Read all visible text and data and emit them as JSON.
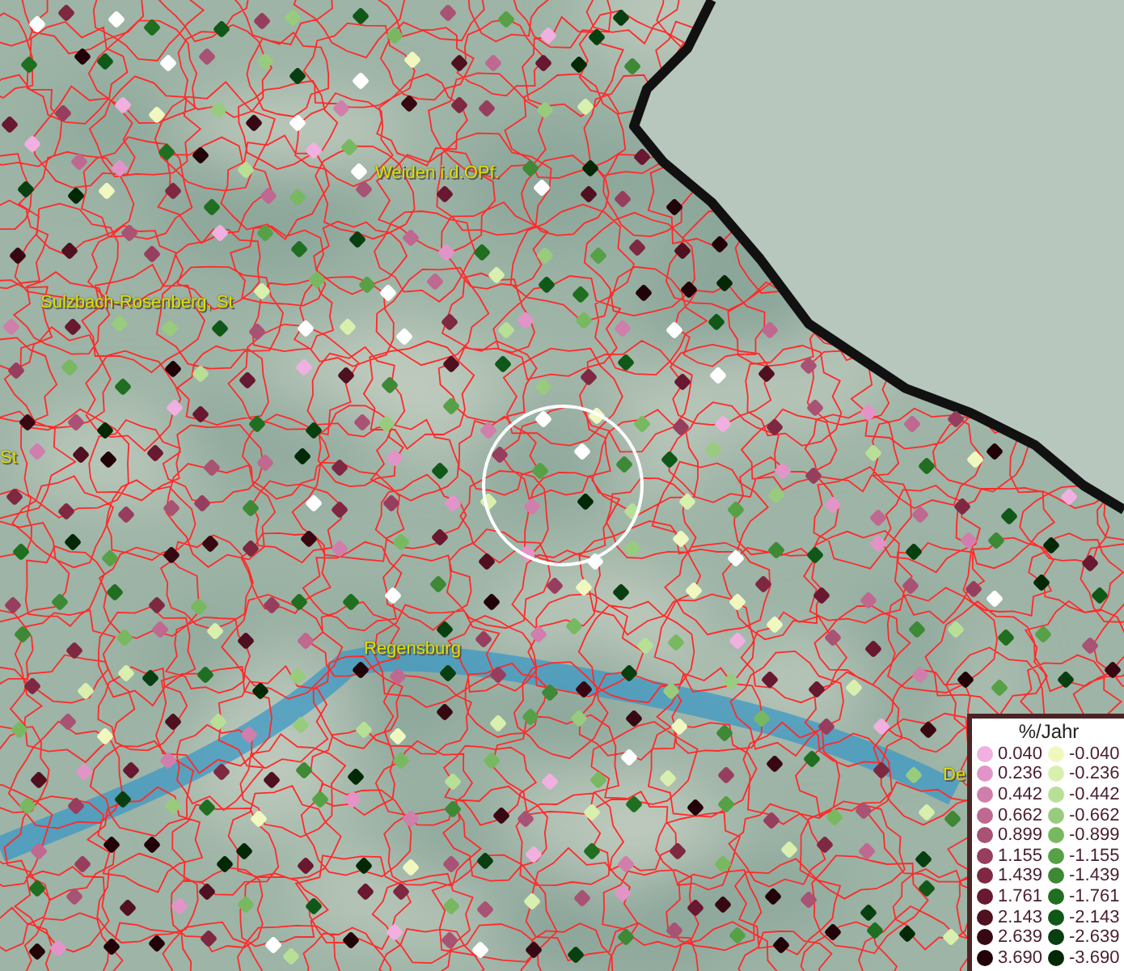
{
  "map": {
    "labels": [
      {
        "text": "Weiden i.d.OPf."
      },
      {
        "text": "Sulzbach-Rosenberg, St"
      },
      {
        "text": "St"
      },
      {
        "text": "Regensburg"
      },
      {
        "text": "De"
      }
    ]
  },
  "legend": {
    "title": "%/Jahr",
    "positive": [
      {
        "value": "0.040",
        "color": "#f0b0e0"
      },
      {
        "value": "0.236",
        "color": "#e294c8"
      },
      {
        "value": "0.442",
        "color": "#d07eac"
      },
      {
        "value": "0.662",
        "color": "#bf6890"
      },
      {
        "value": "0.899",
        "color": "#a85274"
      },
      {
        "value": "1.155",
        "color": "#973e5e"
      },
      {
        "value": "1.439",
        "color": "#7e2842"
      },
      {
        "value": "1.761",
        "color": "#681830"
      },
      {
        "value": "2.143",
        "color": "#4f1020"
      },
      {
        "value": "2.639",
        "color": "#380812"
      },
      {
        "value": "3.690",
        "color": "#210208"
      }
    ],
    "negative": [
      {
        "value": "-0.040",
        "color": "#f0f8c0"
      },
      {
        "value": "-0.236",
        "color": "#d8efae"
      },
      {
        "value": "-0.442",
        "color": "#b8df96"
      },
      {
        "value": "-0.662",
        "color": "#98cb7e"
      },
      {
        "value": "-0.899",
        "color": "#78b860"
      },
      {
        "value": "-1.155",
        "color": "#56a046"
      },
      {
        "value": "-1.439",
        "color": "#3e8836"
      },
      {
        "value": "-1.761",
        "color": "#206e20"
      },
      {
        "value": "-2.143",
        "color": "#105818"
      },
      {
        "value": "-2.639",
        "color": "#083f10"
      },
      {
        "value": "-3.690",
        "color": "#032806"
      }
    ]
  }
}
